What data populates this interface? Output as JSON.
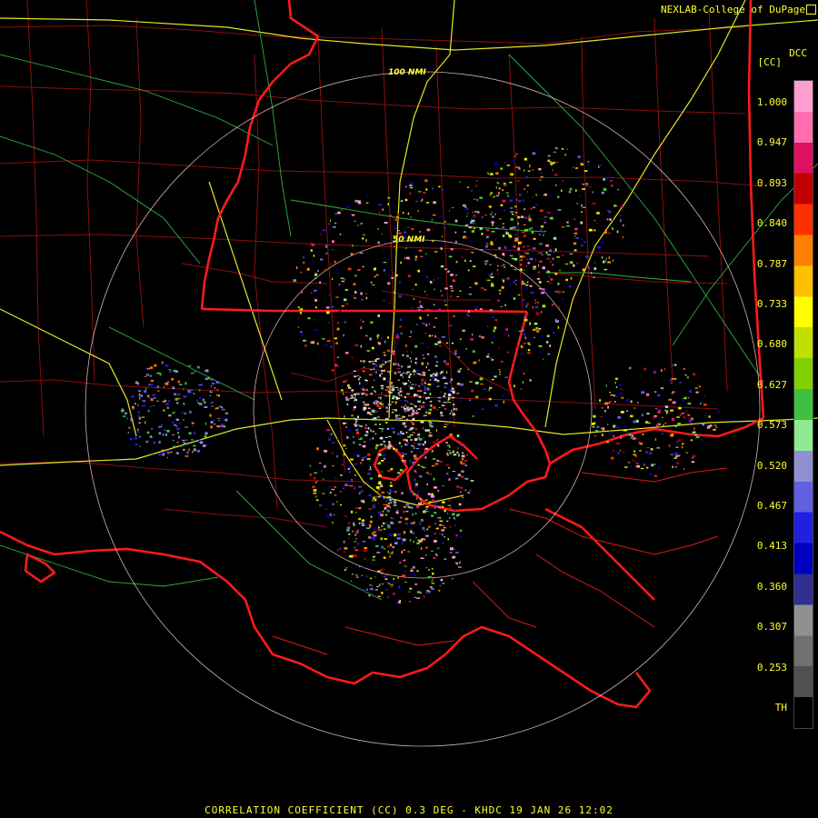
{
  "header": {
    "credit": "NEXLAB-College of DuPage",
    "product_code": "DCC",
    "unit": "[CC]"
  },
  "range_rings": {
    "outer": "100 NMI",
    "inner": "50 NMI"
  },
  "legend": {
    "ticks": [
      "1.000",
      "0.947",
      "0.893",
      "0.840",
      "0.787",
      "0.733",
      "0.680",
      "0.627",
      "0.573",
      "0.520",
      "0.467",
      "0.413",
      "0.360",
      "0.307",
      "0.253",
      "TH"
    ],
    "colors": [
      "#ff9fd0",
      "#ff6fb0",
      "#e01060",
      "#c00000",
      "#ff3000",
      "#ff8000",
      "#ffc000",
      "#ffff00",
      "#c0e000",
      "#80d000",
      "#40c040",
      "#90e890",
      "#9090d0",
      "#6060e0",
      "#2020e0",
      "#0000c0",
      "#303090",
      "#909090",
      "#707070",
      "#505050",
      "#000000"
    ]
  },
  "footer": {
    "caption": "CORRELATION COEFFICIENT (CC) 0.3 DEG - KHDC 19 JAN 26 12:02"
  }
}
